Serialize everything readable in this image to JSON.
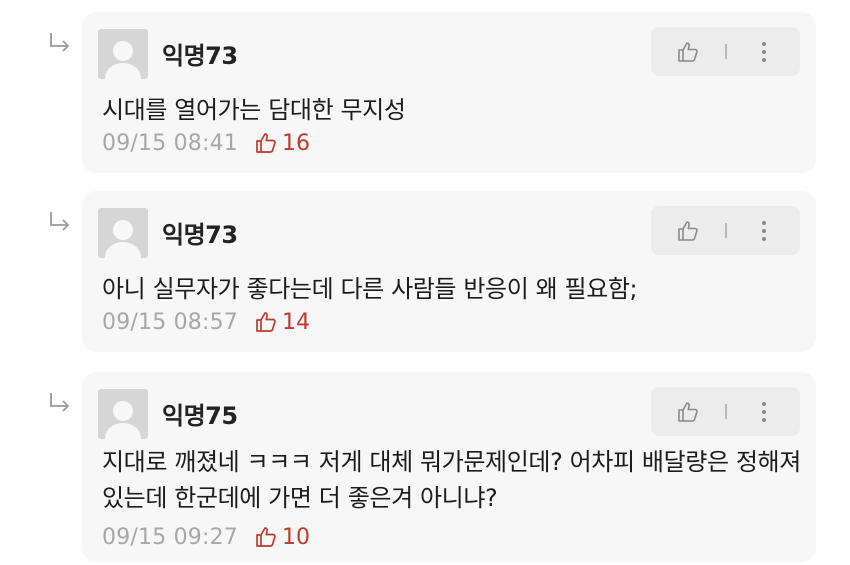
{
  "comments": [
    {
      "nickname": "익명73",
      "text": "시대를 열어가는 담대한 무지성",
      "time": "09/15 08:41",
      "likes": "16"
    },
    {
      "nickname": "익명73",
      "text": "아니 실무자가 좋다는데 다른 사람들 반응이 왜 필요함;",
      "time": "09/15 08:57",
      "likes": "14"
    },
    {
      "nickname": "익명75",
      "text": "지대로 깨졌네 ㅋㅋㅋ 저게 대체 뭐가문제인데? 어차피 배달량은 정해져있는데 한군데에 가면 더 좋은겨 아니냐?",
      "time": "09/15 09:27",
      "likes": "10"
    }
  ],
  "icons": {
    "reply": "reply-arrow-icon",
    "like": "thumbs-up-icon",
    "more": "more-vertical-icon"
  },
  "colors": {
    "like_count": "#c0392b",
    "card_bg": "#f7f7f7",
    "timestamp": "#a7a7a7"
  }
}
